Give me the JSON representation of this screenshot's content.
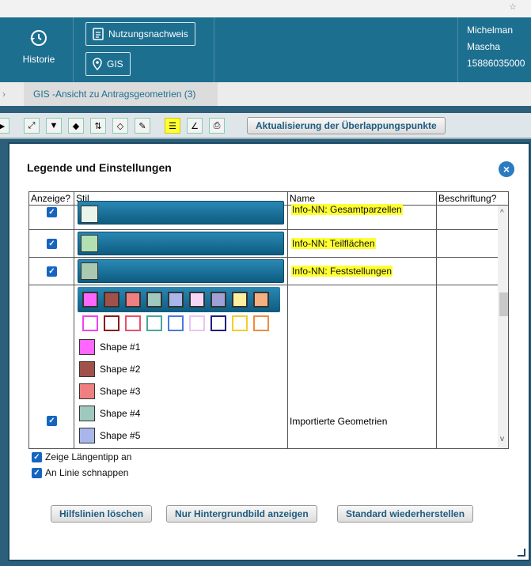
{
  "header": {
    "history_label": "Historie",
    "nutzung_label": "Nutzungsnachweis",
    "gis_label": "GIS",
    "user_lines": [
      "Michelman",
      "Mascha",
      "15886035000"
    ]
  },
  "tab": {
    "label": "GIS -Ansicht zu Antragsgeometrien (3)"
  },
  "toolbar": {
    "update_button": "Aktualisierung der Überlappungspunkte"
  },
  "dialog": {
    "title": "Legende und Einstellungen",
    "columns": [
      "Anzeige?",
      "Stil",
      "Name",
      "Beschriftung?"
    ],
    "rows": [
      {
        "name": "Info-NN: Gesamtparzellen",
        "swatch": "#e8f5e8",
        "checked": true
      },
      {
        "name": "Info-NN: Teilflächen",
        "swatch": "#b3e0b3",
        "checked": true
      },
      {
        "name": "Info-NN: Feststellungen",
        "swatch": "#a9c9b0",
        "checked": true
      }
    ],
    "shape_colors": [
      "#ff66ff",
      "#a0524a",
      "#f08080",
      "#9fc9bf",
      "#a9b6ec",
      "#f6d8f6",
      "#9fa0d6",
      "#fff0a0",
      "#f4b080"
    ],
    "outline_colors": [
      "#ee44ee",
      "#8a1c1c",
      "#e8506a",
      "#4aa59a",
      "#4a7ae0",
      "#eac3f2",
      "#202080",
      "#f2cc30",
      "#ef8c40"
    ],
    "shapes": [
      {
        "label": "Shape #1",
        "color": "#ff66ff"
      },
      {
        "label": "Shape #2",
        "color": "#a0524a"
      },
      {
        "label": "Shape #3",
        "color": "#f08080"
      },
      {
        "label": "Shape #4",
        "color": "#9fc9bf"
      },
      {
        "label": "Shape #5",
        "color": "#a9b6ec"
      }
    ],
    "imported_name": "Importierte Geometrien",
    "option_laengentipp": "Zeige Längentipp an",
    "option_schnappen": "An Linie schnappen",
    "buttons": {
      "clear": "Hilfslinien löschen",
      "background": "Nur Hintergrundbild anzeigen",
      "restore": "Standard wiederherstellen"
    }
  }
}
